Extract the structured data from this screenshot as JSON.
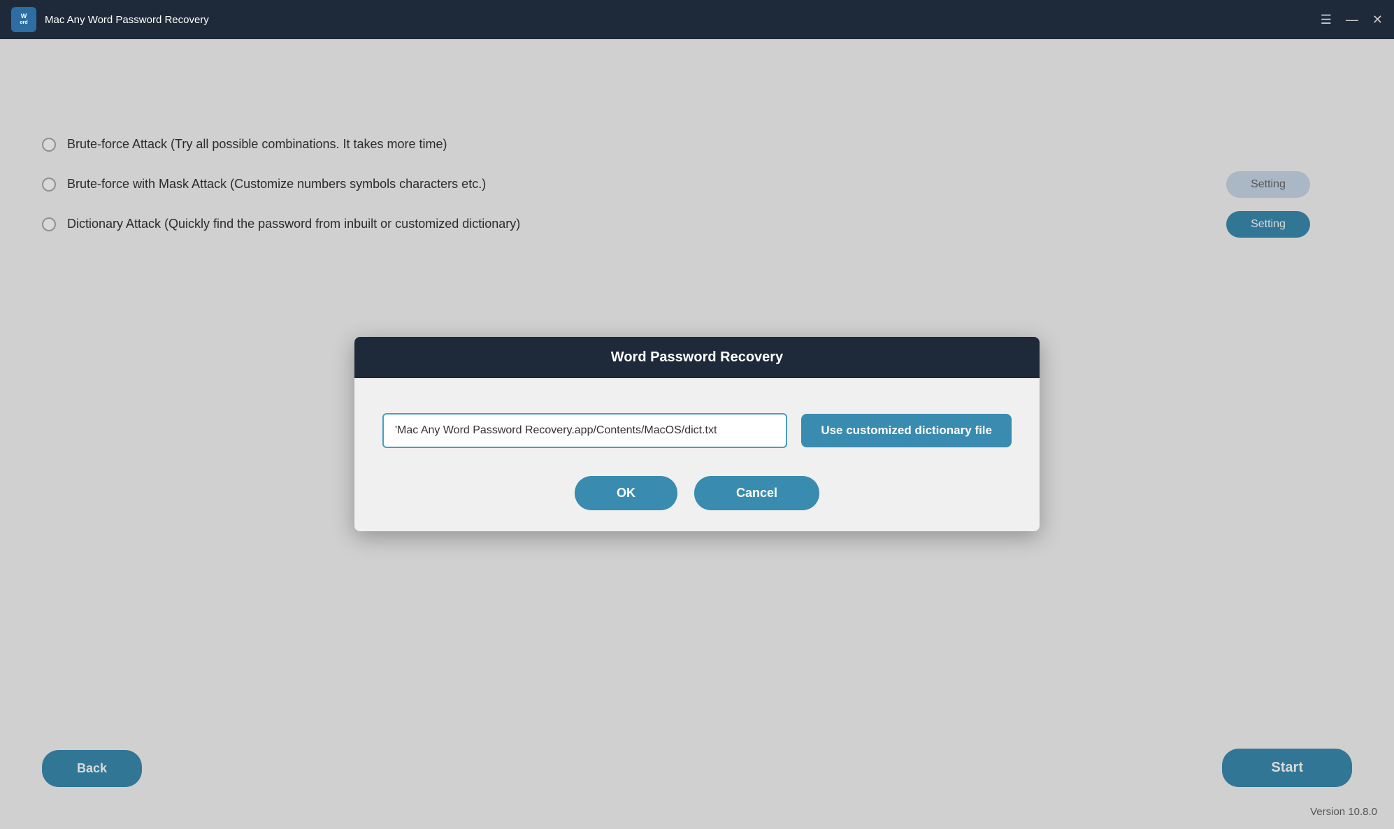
{
  "titleBar": {
    "title": "Mac Any Word Password Recovery",
    "iconTopLine": "Word",
    "menuIcon": "☰",
    "minimizeIcon": "—",
    "closeIcon": "✕"
  },
  "attackOptions": [
    {
      "id": "brute-force",
      "label": "Brute-force Attack (Try all possible combinations. It takes more time)",
      "hasSettingButton": false
    },
    {
      "id": "brute-force-mask",
      "label": "Brute-force with Mask Attack (Customize numbers symbols characters etc.)",
      "hasSettingButton": true,
      "settingButtonLabel": "Setting",
      "settingButtonActive": false
    },
    {
      "id": "dictionary",
      "label": "Dictionary Attack (Quickly find the password from inbuilt or customized dictionary)",
      "hasSettingButton": true,
      "settingButtonLabel": "Setting",
      "settingButtonActive": true
    }
  ],
  "dialog": {
    "title": "Word Password Recovery",
    "inputValue": "'Mac Any Word Password Recovery.app/Contents/MacOS/dict.txt",
    "inputPlaceholder": "",
    "useDictButtonLabel": "Use customized dictionary file",
    "okButtonLabel": "OK",
    "cancelButtonLabel": "Cancel"
  },
  "footer": {
    "backButtonLabel": "Back",
    "startButtonLabel": "Start",
    "versionText": "Version 10.8.0"
  }
}
